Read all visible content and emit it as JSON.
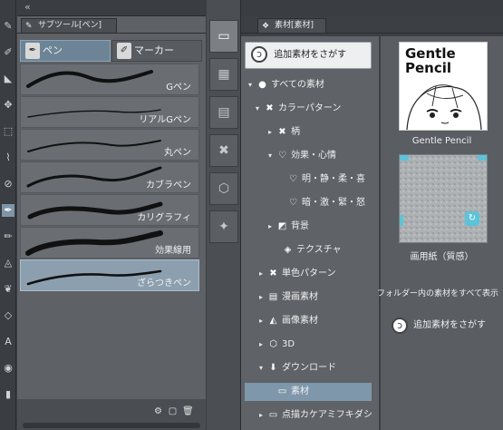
{
  "tool_strip": {
    "tools": [
      {
        "icon": "pen-nib-icon",
        "glyph": "✎",
        "selected": false
      },
      {
        "icon": "brush-icon",
        "glyph": "✐",
        "selected": false
      },
      {
        "icon": "eraser-icon",
        "glyph": "◣",
        "selected": false
      },
      {
        "icon": "move-icon",
        "glyph": "✥",
        "selected": false
      },
      {
        "icon": "select-rect-icon",
        "glyph": "⬚",
        "selected": false
      },
      {
        "icon": "lasso-icon",
        "glyph": "⌇",
        "selected": false
      },
      {
        "icon": "eyedropper-icon",
        "glyph": "⊘",
        "selected": false
      },
      {
        "icon": "pen-icon",
        "glyph": "✒",
        "selected": true
      },
      {
        "icon": "pencil-icon",
        "glyph": "✏",
        "selected": false
      },
      {
        "icon": "airbrush-icon",
        "glyph": "◬",
        "selected": false
      },
      {
        "icon": "decoration-icon",
        "glyph": "❦",
        "selected": false
      },
      {
        "icon": "figure-icon",
        "glyph": "◇",
        "selected": false
      },
      {
        "icon": "text-icon",
        "glyph": "A",
        "selected": false
      },
      {
        "icon": "fill-icon",
        "glyph": "◉",
        "selected": false
      },
      {
        "icon": "gradient-icon",
        "glyph": "▮",
        "selected": false
      }
    ]
  },
  "subtool_panel": {
    "tab_title": "サブツール[ペン]",
    "groups": [
      {
        "label": "ペン",
        "selected": true
      },
      {
        "label": "マーカー",
        "selected": false
      }
    ],
    "brushes": [
      {
        "label": "Gペン",
        "selected": false
      },
      {
        "label": "リアルGペン",
        "selected": false
      },
      {
        "label": "丸ペン",
        "selected": false
      },
      {
        "label": "カブラペン",
        "selected": false
      },
      {
        "label": "カリグラフィ",
        "selected": false
      },
      {
        "label": "効果線用",
        "selected": false
      },
      {
        "label": "ざらつきペン",
        "selected": true
      }
    ]
  },
  "material_panel": {
    "tab_title": "素材[素材]",
    "search_label": "追加素材をさがす",
    "tree": [
      {
        "label": "すべての素材",
        "arrow": "▾",
        "icon": "●",
        "icon_name": "all-materials-icon"
      },
      {
        "label": "カラーパターン",
        "arrow": "▾",
        "icon": "✖",
        "icon_name": "color-pattern-icon"
      },
      {
        "label": "柄",
        "arrow": "▸",
        "icon": "✖",
        "icon_name": "pattern-icon"
      },
      {
        "label": "効果・心情",
        "arrow": "▾",
        "icon": "♡",
        "icon_name": "heart-icon"
      },
      {
        "label": "明・静・柔・喜",
        "arrow": "",
        "icon": "♡",
        "icon_name": "heart-icon"
      },
      {
        "label": "暗・激・緊・怒",
        "arrow": "",
        "icon": "♡",
        "icon_name": "heart-icon"
      },
      {
        "label": "背景",
        "arrow": "▸",
        "icon": "◩",
        "icon_name": "background-icon"
      },
      {
        "label": "テクスチャ",
        "arrow": "",
        "icon": "◈",
        "icon_name": "texture-icon"
      },
      {
        "label": "単色パターン",
        "arrow": "▸",
        "icon": "✖",
        "icon_name": "mono-pattern-icon"
      },
      {
        "label": "漫画素材",
        "arrow": "▸",
        "icon": "▤",
        "icon_name": "manga-material-icon"
      },
      {
        "label": "画像素材",
        "arrow": "▸",
        "icon": "◭",
        "icon_name": "image-material-icon"
      },
      {
        "label": "3D",
        "arrow": "▸",
        "icon": "⬡",
        "icon_name": "cube-icon"
      },
      {
        "label": "ダウンロード",
        "arrow": "▾",
        "icon": "⬇",
        "icon_name": "download-icon"
      },
      {
        "label": "素材",
        "arrow": "",
        "icon": "▭",
        "icon_name": "folder-icon"
      },
      {
        "label": "点描カケアミフキダシ",
        "arrow": "▸",
        "icon": "▭",
        "icon_name": "folder-icon"
      }
    ],
    "thumbnails": [
      {
        "title": "Gentle\nPencil",
        "caption": "Gentle Pencil"
      },
      {
        "title": "",
        "caption": "画用紙（質感）"
      }
    ],
    "show_all_label": "フォルダー内の素材をすべて表示",
    "search_label_2": "追加素材をさがす"
  }
}
